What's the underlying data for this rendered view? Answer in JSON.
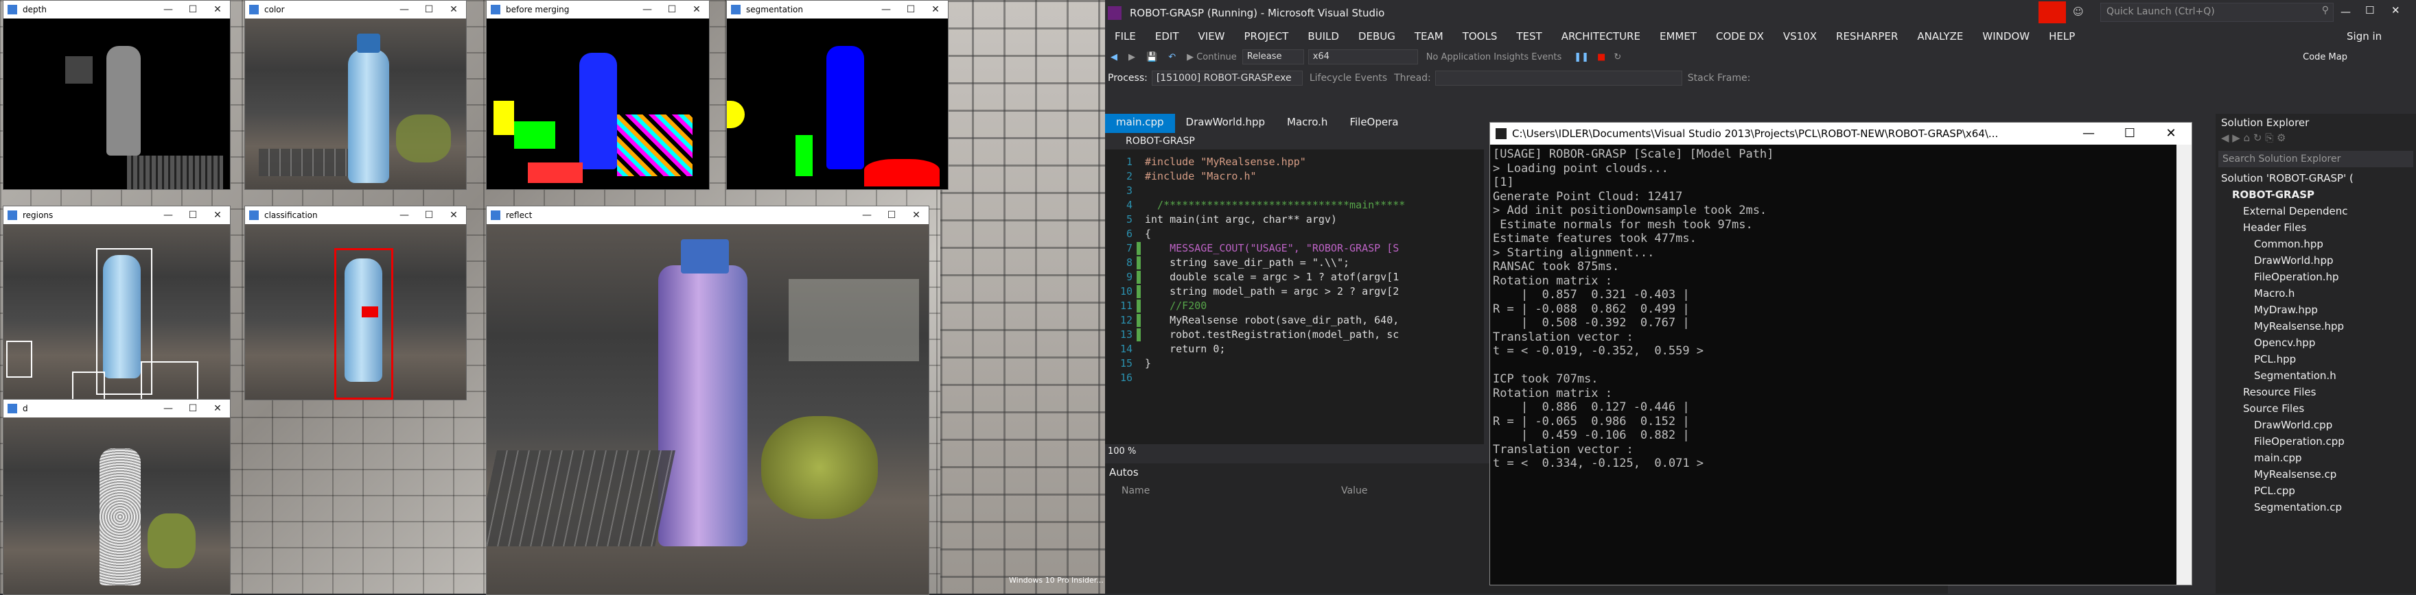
{
  "cv_windows": {
    "depth": {
      "title": "depth"
    },
    "color": {
      "title": "color"
    },
    "before_merging": {
      "title": "before merging"
    },
    "segmentation": {
      "title": "segmentation"
    },
    "regions": {
      "title": "regions"
    },
    "classification": {
      "title": "classification"
    },
    "reflect": {
      "title": "reflect"
    },
    "d": {
      "title": "d"
    }
  },
  "desktop_watermark": "Windows 10 Pro Insider...",
  "vs": {
    "title": "ROBOT-GRASP (Running) - Microsoft Visual Studio",
    "quick_launch_placeholder": "Quick Launch (Ctrl+Q)",
    "sign_in": "Sign in",
    "menu": [
      "FILE",
      "EDIT",
      "VIEW",
      "PROJECT",
      "BUILD",
      "DEBUG",
      "TEAM",
      "TOOLS",
      "TEST",
      "ARCHITECTURE",
      "EMMET",
      "CODE DX",
      "VS10X",
      "RESHARPER",
      "ANALYZE",
      "WINDOW",
      "HELP"
    ],
    "toolbar": {
      "continue": "Continue",
      "config": "Release",
      "platform": "x64",
      "insights": "No Application Insights Events",
      "code_map": "Code Map"
    },
    "process_label": "Process:",
    "process_value": "[151000] ROBOT-GRASP.exe",
    "lifecycle": "Lifecycle Events",
    "thread_label": "Thread:",
    "stack_frame": "Stack Frame:",
    "tabs": [
      "main.cpp",
      "DrawWorld.hpp",
      "Macro.h",
      "FileOpera"
    ],
    "scope": "ROBOT-GRASP",
    "zoom": "100 %",
    "code_lines": [
      {
        "n": "1",
        "t": "#include \"MyRealsense.hpp\""
      },
      {
        "n": "2",
        "t": "#include \"Macro.h\""
      },
      {
        "n": "3",
        "t": ""
      },
      {
        "n": "4",
        "t": "  /******************************main*****"
      },
      {
        "n": "5",
        "t": "int main(int argc, char** argv)"
      },
      {
        "n": "6",
        "t": "{"
      },
      {
        "n": "7",
        "t": "    MESSAGE_COUT(\"USAGE\", \"ROBOR-GRASP [S"
      },
      {
        "n": "8",
        "t": "    string save_dir_path = \".\\\\\";"
      },
      {
        "n": "9",
        "t": "    double scale = argc > 1 ? atof(argv[1"
      },
      {
        "n": "10",
        "t": "    string model_path = argc > 2 ? argv[2"
      },
      {
        "n": "11",
        "t": "    //F200"
      },
      {
        "n": "12",
        "t": "    MyRealsense robot(save_dir_path, 640,"
      },
      {
        "n": "13",
        "t": "    robot.testRegistration(model_path, sc"
      },
      {
        "n": "14",
        "t": "    return 0;"
      },
      {
        "n": "15",
        "t": "}"
      },
      {
        "n": "16",
        "t": ""
      }
    ],
    "autos": {
      "title": "Autos",
      "col_name": "Name",
      "col_value": "Value"
    },
    "console": {
      "title": "C:\\Users\\IDLER\\Documents\\Visual Studio 2013\\Projects\\PCL\\ROBOT-NEW\\ROBOT-GRASP\\x64\\...",
      "lines": [
        "[USAGE] ROBOR-GRASP [Scale] [Model Path]",
        "> Loading point clouds...",
        "[1]",
        "Generate Point Cloud: 12417",
        "> Add init positionDownsample took 2ms.",
        " Estimate normals for mesh took 97ms.",
        "Estimate features took 477ms.",
        "> Starting alignment...",
        "RANSAC took 875ms.",
        "Rotation matrix :",
        "    |  0.857  0.321 -0.403 |",
        "R = | -0.088  0.862  0.499 |",
        "    |  0.508 -0.392  0.767 |",
        "Translation vector :",
        "t = < -0.019, -0.352,  0.559 >",
        "",
        "ICP took 707ms.",
        "Rotation matrix :",
        "    |  0.886  0.127 -0.446 |",
        "R = | -0.065  0.986  0.152 |",
        "    |  0.459 -0.106  0.882 |",
        "Translation vector :",
        "t = <  0.334, -0.125,  0.071 >"
      ]
    },
    "solution_explorer": {
      "title": "Solution Explorer",
      "search_placeholder": "Search Solution Explorer",
      "items": [
        {
          "label": "Solution 'ROBOT-GRASP' (",
          "indent": 0
        },
        {
          "label": "ROBOT-GRASP",
          "indent": 1,
          "bold": true
        },
        {
          "label": "External Dependenc",
          "indent": 2
        },
        {
          "label": "Header Files",
          "indent": 2
        },
        {
          "label": "Common.hpp",
          "indent": 3
        },
        {
          "label": "DrawWorld.hpp",
          "indent": 3
        },
        {
          "label": "FileOperation.hp",
          "indent": 3
        },
        {
          "label": "Macro.h",
          "indent": 3
        },
        {
          "label": "MyDraw.hpp",
          "indent": 3
        },
        {
          "label": "MyRealsense.hpp",
          "indent": 3
        },
        {
          "label": "Opencv.hpp",
          "indent": 3
        },
        {
          "label": "PCL.hpp",
          "indent": 3
        },
        {
          "label": "Segmentation.h",
          "indent": 3
        },
        {
          "label": "Resource Files",
          "indent": 2
        },
        {
          "label": "Source Files",
          "indent": 2
        },
        {
          "label": "DrawWorld.cpp",
          "indent": 3
        },
        {
          "label": "FileOperation.cpp",
          "indent": 3
        },
        {
          "label": "main.cpp",
          "indent": 3
        },
        {
          "label": "MyRealsense.cp",
          "indent": 3
        },
        {
          "label": "PCL.cpp",
          "indent": 3
        },
        {
          "label": "Segmentation.cp",
          "indent": 3
        }
      ]
    }
  }
}
